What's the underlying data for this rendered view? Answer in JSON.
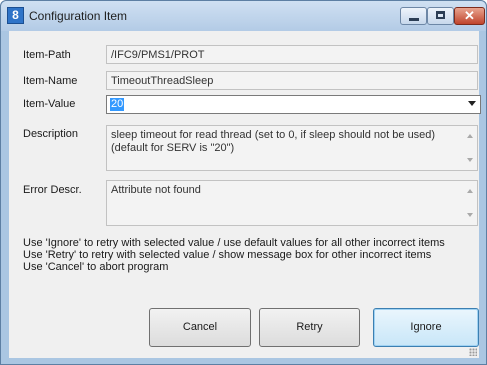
{
  "window": {
    "title": "Configuration Item",
    "icon": "app-logo-icon",
    "icon_glyph": "8",
    "caption_buttons": {
      "minimize": "minimize-icon",
      "maximize": "maximize-icon",
      "close": "close-icon",
      "close_glyph": "✕"
    }
  },
  "form": {
    "item_path": {
      "label": "Item-Path",
      "value": "/IFC9/PMS1/PROT"
    },
    "item_name": {
      "label": "Item-Name",
      "value": "TimeoutThreadSleep"
    },
    "item_value": {
      "label": "Item-Value",
      "value": "20"
    },
    "description": {
      "label": "Description",
      "value": "sleep timeout for read thread (set to 0, if sleep should not be used) (default for SERV is \"20\")"
    },
    "error": {
      "label": "Error Descr.",
      "value": "Attribute not found"
    }
  },
  "hints": [
    "Use 'Ignore' to retry with selected value / use default values for all other incorrect items",
    "Use 'Retry' to retry with selected value / show message box for other incorrect items",
    "Use 'Cancel' to abort program"
  ],
  "buttons": {
    "cancel": "Cancel",
    "retry": "Retry",
    "ignore": "Ignore"
  },
  "colors": {
    "selection": "#3399ff",
    "default_button_border": "#3c7fb1",
    "close_button": "#c0442c"
  }
}
